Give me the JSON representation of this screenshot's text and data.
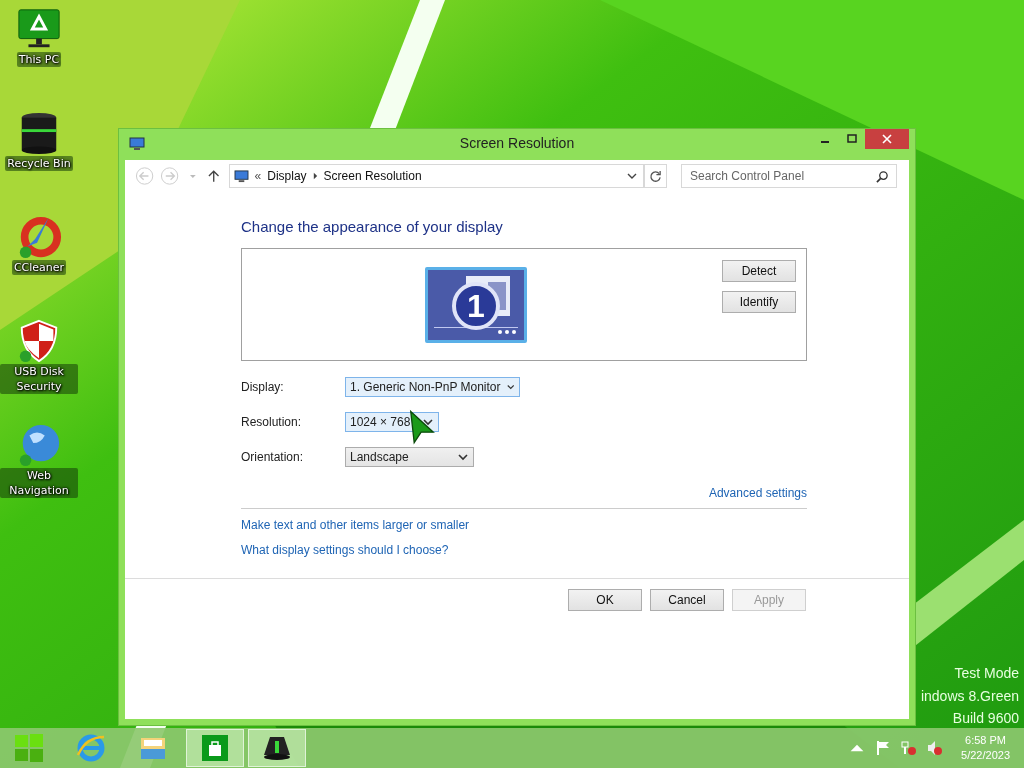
{
  "desktop_icons": [
    {
      "kind": "monitor",
      "label": "This PC"
    },
    {
      "kind": "bin",
      "label": "Recycle Bin"
    },
    {
      "kind": "cleaner",
      "label": "CCleaner"
    },
    {
      "kind": "shield",
      "label": "USB Disk Security"
    },
    {
      "kind": "globe",
      "label": "Web Navigation"
    }
  ],
  "watermark": [
    "Test Mode",
    "indows 8.Green",
    "Build 9600"
  ],
  "window": {
    "title": "Screen Resolution"
  },
  "address_bar": {
    "overflow": "«",
    "crumbs": [
      "Display",
      "Screen Resolution"
    ]
  },
  "search": {
    "placeholder": "Search Control Panel"
  },
  "heading": "Change the appearance of your display",
  "monitor": {
    "number": "1"
  },
  "side_buttons": [
    "Detect",
    "Identify"
  ],
  "settings": [
    {
      "label": "Display:",
      "value": "1. Generic Non-PnP Monitor"
    },
    {
      "label": "Resolution:",
      "value": "1024 × 768"
    },
    {
      "label": "Orientation:",
      "value": "Landscape"
    }
  ],
  "advanced_link": "Advanced settings",
  "links": [
    "Make text and other items larger or smaller",
    "What display settings should I choose?"
  ],
  "dialog_buttons": [
    {
      "label": "OK",
      "disabled": false
    },
    {
      "label": "Cancel",
      "disabled": false
    },
    {
      "label": "Apply",
      "disabled": true
    }
  ],
  "taskbar": [
    {
      "kind": "start",
      "running": false
    },
    {
      "kind": "browser",
      "running": false
    },
    {
      "kind": "folder",
      "running": false
    },
    {
      "kind": "store",
      "running": true
    },
    {
      "kind": "app",
      "running": true
    }
  ],
  "tray": [
    {
      "kind": "arrow"
    },
    {
      "kind": "flag"
    },
    {
      "kind": "network"
    },
    {
      "kind": "speaker"
    }
  ],
  "clock": {
    "time": "6:58 PM",
    "date": "5/22/2023"
  }
}
